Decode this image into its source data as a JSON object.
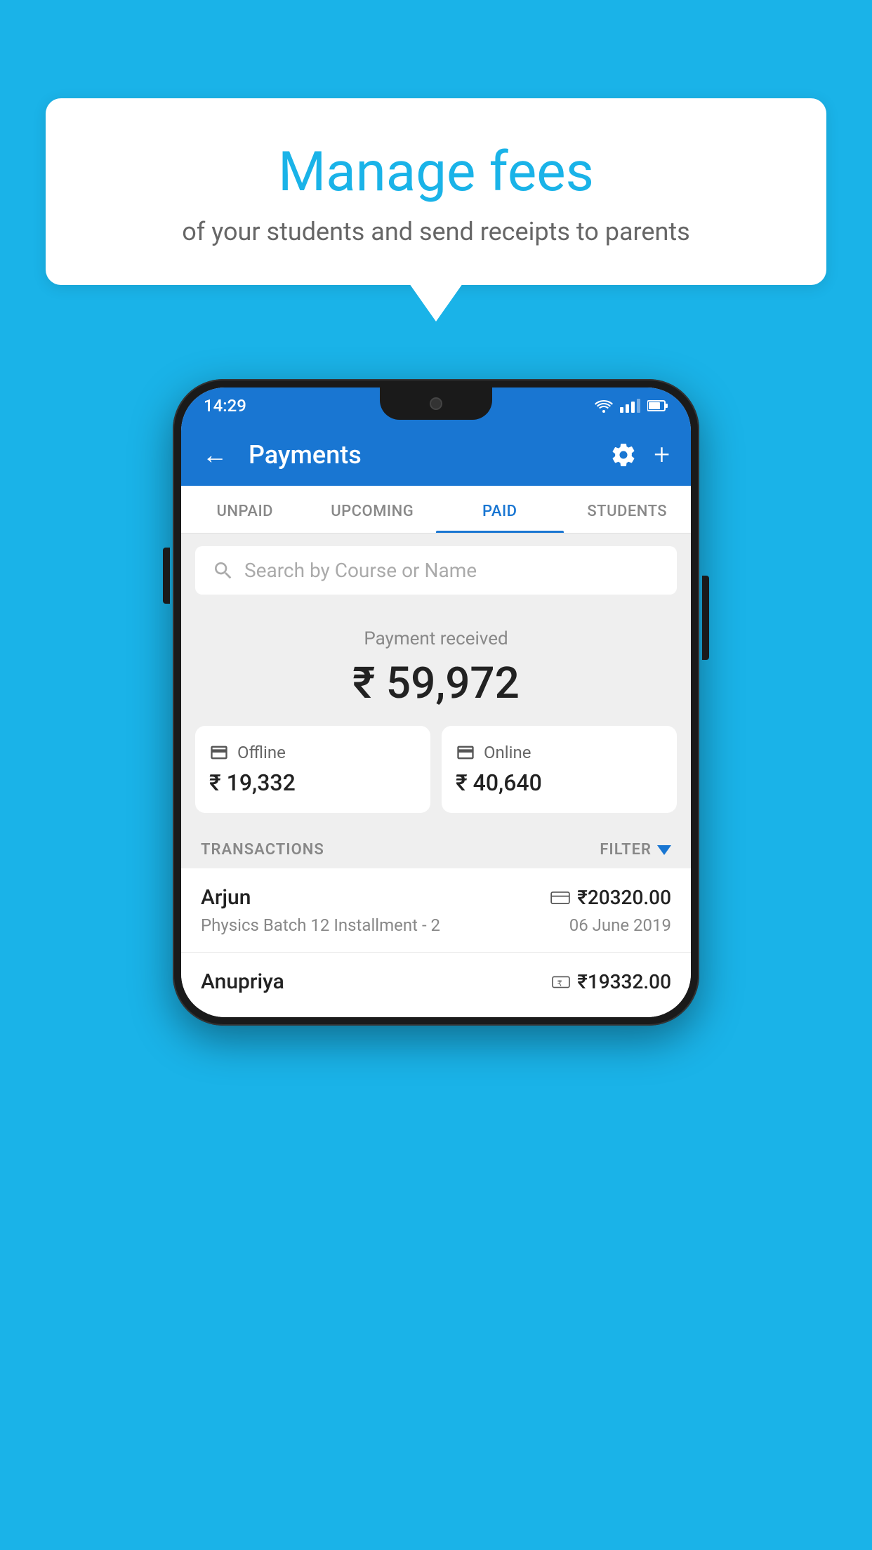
{
  "background_color": "#1ab3e8",
  "hero": {
    "title": "Manage fees",
    "subtitle": "of your students and send receipts to parents"
  },
  "status_bar": {
    "time": "14:29",
    "wifi": "▼",
    "battery_label": "battery"
  },
  "app_bar": {
    "back_label": "←",
    "title": "Payments",
    "gear_label": "⚙",
    "plus_label": "+"
  },
  "tabs": [
    {
      "label": "UNPAID",
      "active": false
    },
    {
      "label": "UPCOMING",
      "active": false
    },
    {
      "label": "PAID",
      "active": true
    },
    {
      "label": "STUDENTS",
      "active": false
    }
  ],
  "search": {
    "placeholder": "Search by Course or Name"
  },
  "payment_summary": {
    "label": "Payment received",
    "total": "₹ 59,972",
    "offline": {
      "label": "Offline",
      "amount": "₹ 19,332"
    },
    "online": {
      "label": "Online",
      "amount": "₹ 40,640"
    }
  },
  "transactions": {
    "label": "TRANSACTIONS",
    "filter_label": "FILTER",
    "items": [
      {
        "name": "Arjun",
        "course": "Physics Batch 12 Installment - 2",
        "amount": "₹20320.00",
        "date": "06 June 2019",
        "payment_type": "card"
      },
      {
        "name": "Anupriya",
        "course": "",
        "amount": "₹19332.00",
        "date": "",
        "payment_type": "rupee"
      }
    ]
  }
}
